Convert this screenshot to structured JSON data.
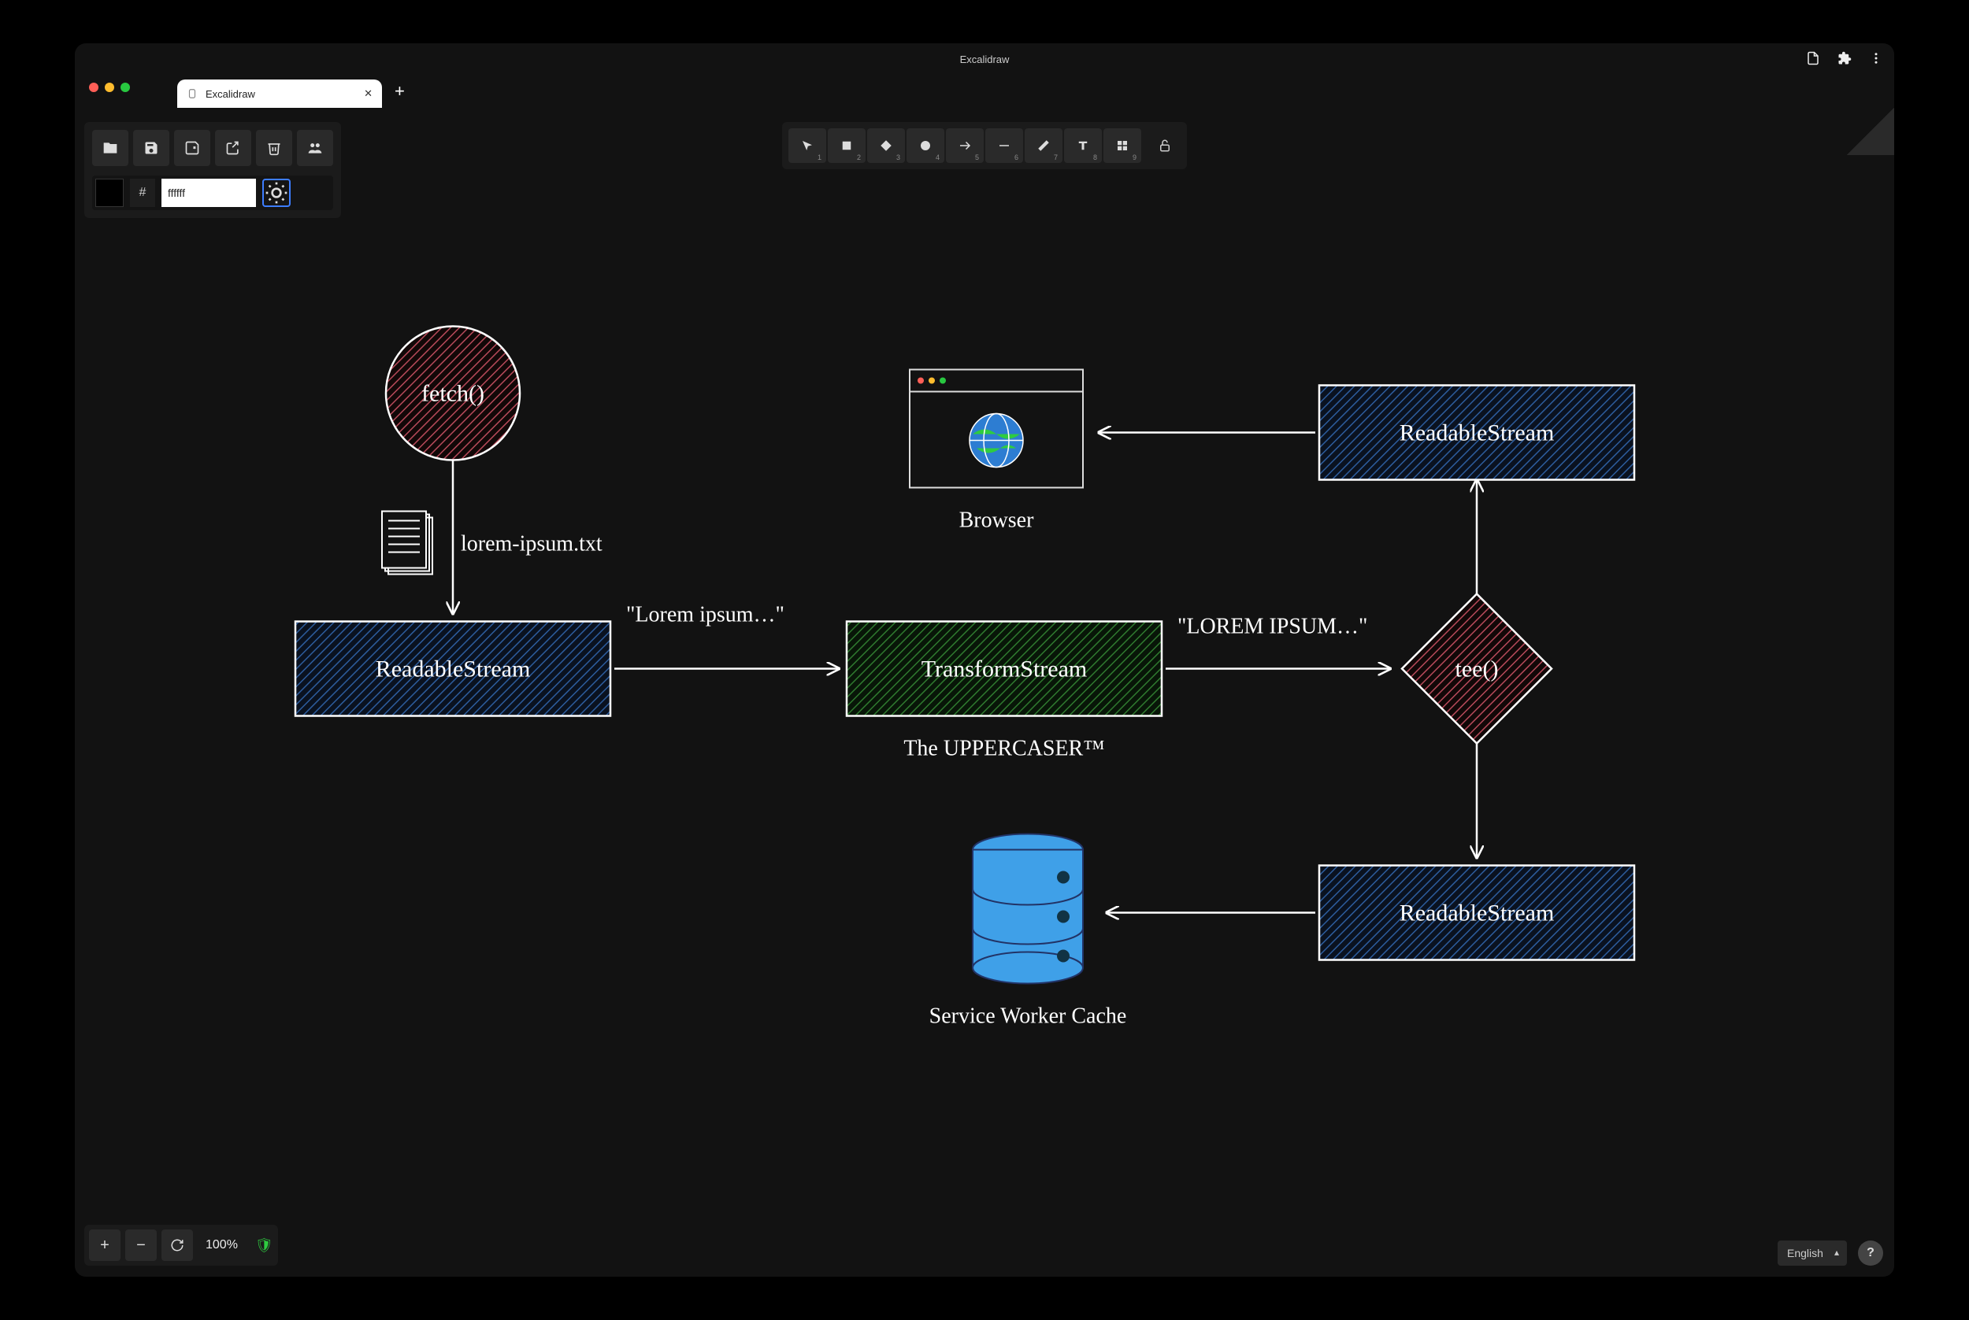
{
  "window": {
    "title": "Excalidraw"
  },
  "tab": {
    "label": "Excalidraw"
  },
  "color_input": {
    "hash": "#",
    "value": "ffffff"
  },
  "tools": {
    "t1_num": "1",
    "t2_num": "2",
    "t3_num": "3",
    "t4_num": "4",
    "t5_num": "5",
    "t6_num": "6",
    "t7_num": "7",
    "t8_num": "8",
    "t9_num": "9"
  },
  "zoom": {
    "pct": "100%"
  },
  "lang": {
    "value": "English"
  },
  "diagram": {
    "fetch_label": "fetch()",
    "file_label": "lorem-ipsum.txt",
    "readable_left": "ReadableStream",
    "edge_lorem": "\"Lorem ipsum…\"",
    "transform": "TransformStream",
    "transform_sub": "The UPPERCASER™",
    "edge_upper": "\"LOREM IPSUM…\"",
    "tee": "tee()",
    "readable_top": "ReadableStream",
    "readable_bottom": "ReadableStream",
    "browser_label": "Browser",
    "cache_label": "Service Worker Cache"
  }
}
